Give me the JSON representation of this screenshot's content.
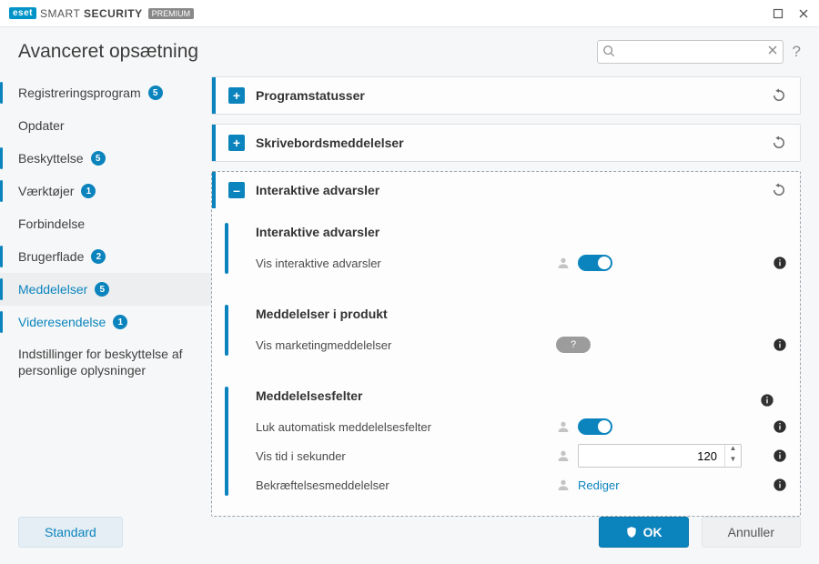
{
  "brand": {
    "logo": "eset",
    "product_light": "SMART",
    "product_bold": "SECURITY",
    "edition": "PREMIUM"
  },
  "page": {
    "title": "Avanceret opsætning"
  },
  "search": {
    "placeholder": ""
  },
  "sidebar": {
    "items": [
      {
        "label": "Registreringsprogram",
        "badge": "5"
      },
      {
        "label": "Opdater"
      },
      {
        "label": "Beskyttelse",
        "badge": "5"
      },
      {
        "label": "Værktøjer",
        "badge": "1"
      },
      {
        "label": "Forbindelse"
      },
      {
        "label": "Brugerflade",
        "badge": "2"
      },
      {
        "label": "Meddelelser",
        "badge": "5"
      },
      {
        "label": "Videresendelse",
        "badge": "1"
      },
      {
        "label": "Indstillinger for beskyttelse af personlige oplysninger"
      }
    ]
  },
  "accordions": {
    "program_status": {
      "title": "Programstatusser"
    },
    "desktop_notifications": {
      "title": "Skrivebordsmeddelelser"
    },
    "interactive_alerts": {
      "title": "Interaktive advarsler",
      "sections": [
        {
          "heading": "Interaktive advarsler",
          "rows": [
            {
              "label": "Vis interaktive advarsler",
              "type": "toggle",
              "value": "on"
            }
          ]
        },
        {
          "heading": "Meddelelser i produkt",
          "rows": [
            {
              "label": "Vis marketingmeddelelser",
              "type": "toggle",
              "value": "unknown"
            }
          ]
        },
        {
          "heading": "Meddelelsesfelter",
          "heading_has_info": true,
          "rows": [
            {
              "label": "Luk automatisk meddelelsesfelter",
              "type": "toggle",
              "value": "on"
            },
            {
              "label": "Vis tid i sekunder",
              "type": "number",
              "value": "120"
            },
            {
              "label": "Bekræftelsesmeddelelser",
              "type": "link",
              "link_text": "Rediger"
            }
          ]
        }
      ]
    }
  },
  "footer": {
    "default": "Standard",
    "ok": "OK",
    "cancel": "Annuller"
  }
}
